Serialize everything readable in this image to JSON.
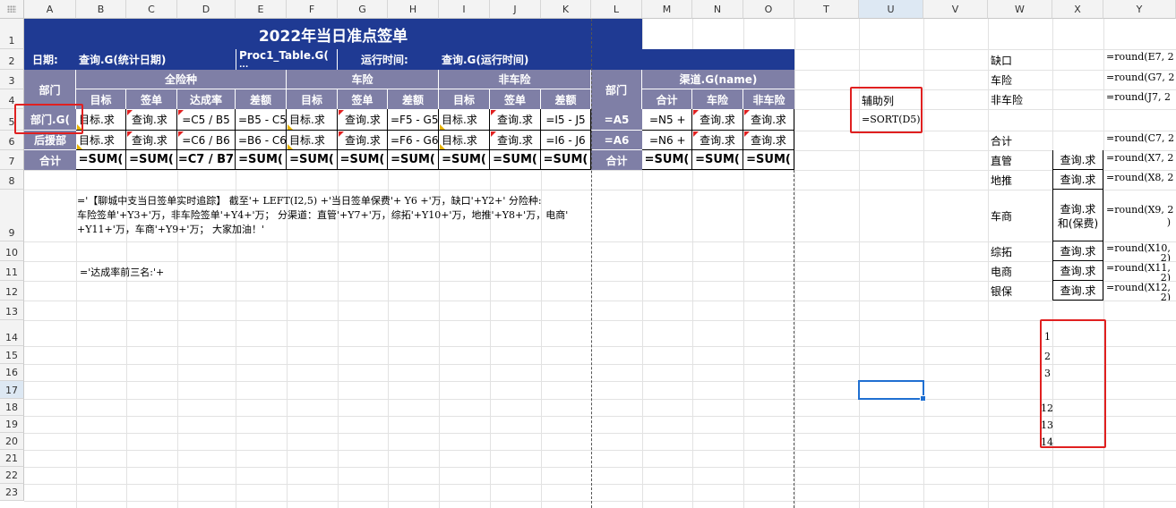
{
  "columns": [
    "A",
    "B",
    "C",
    "D",
    "E",
    "F",
    "G",
    "H",
    "I",
    "J",
    "K",
    "L",
    "M",
    "N",
    "O",
    "T",
    "U",
    "V",
    "W",
    "X",
    "Y"
  ],
  "rows": [
    "1",
    "2",
    "3",
    "4",
    "5",
    "6",
    "7",
    "8",
    "9",
    "10",
    "11",
    "12",
    "13",
    "14",
    "15",
    "16",
    "17",
    "18",
    "19",
    "20",
    "21",
    "22",
    "23"
  ],
  "title": "2022年当日准点签单",
  "row2": {
    "date_label": "日期:",
    "date_value": "查询.G(统计日期)",
    "proc": "Proc1_Table.G(",
    "proc_sub": "...",
    "runtime_label": "运行时间:",
    "runtime_value": "查询.G(运行时间)"
  },
  "headers": {
    "dept": "部门",
    "all": "全险种",
    "auto": "车险",
    "nonauto": "非车险",
    "channel": "渠道.G(name)",
    "dept2": "部门",
    "target": "目标",
    "signed": "签单",
    "rate": "达成率",
    "diff": "差额",
    "total": "合计",
    "car": "车险",
    "noncar": "非车险"
  },
  "row5": {
    "dept": "部门.G(",
    "b": "目标.求",
    "c": "查询.求",
    "d": "=C5 / B5",
    "e": "=B5 - C5",
    "f": "目标.求",
    "g": "查询.求",
    "h": "=F5 - G5",
    "i": "目标.求",
    "j": "查询.求",
    "k": "=I5 - J5",
    "l": "=A5",
    "m": "=N5 +",
    "n": "查询.求",
    "o": "查询.求"
  },
  "row6": {
    "dept": "后援部",
    "b": "目标.求",
    "c": "查询.求",
    "d": "=C6 / B6",
    "e": "=B6 - C6",
    "f": "目标.求",
    "g": "查询.求",
    "h": "=F6 - G6",
    "i": "目标.求",
    "j": "查询.求",
    "k": "=I6 - J6",
    "l": "=A6",
    "m": "=N6 +",
    "n": "查询.求",
    "o": "查询.求"
  },
  "row7": {
    "total": "合计",
    "b": "=SUM(",
    "c": "=SUM(",
    "d": "=C7 / B7",
    "e": "=SUM(",
    "f": "=SUM(",
    "g": "=SUM(",
    "h": "=SUM(",
    "i": "=SUM(",
    "j": "=SUM(",
    "k": "=SUM(",
    "l": "合计",
    "m": "=SUM(",
    "n": "=SUM(",
    "o": "=SUM("
  },
  "formula9": [
    "='【聊城中支当日签单实时追踪】 截至'+ LEFT(I2,5) +'当日签单保费'+ Y6 +'万，缺口'+Y2+' 分险种:",
    "车险签单'+Y3+'万，非车险签单'+Y4+'万； 分渠道：直管'+Y7+'万，综拓'+Y10+'万，地推'+Y8+'万，电商'",
    "+Y11+'万，车商'+Y9+'万； 大家加油！'"
  ],
  "formula11": "='达成率前三名:'+",
  "helper": {
    "label": "辅助列",
    "formula": "=SORT(D5)"
  },
  "right_labels": {
    "r2": "缺口",
    "r3": "车险",
    "r4": "非车险",
    "r6": "合计",
    "r7": "直管",
    "r8": "地推",
    "r9": "车商",
    "r10": "综拓",
    "r11": "电商",
    "r12": "银保"
  },
  "x_col": {
    "r7": "查询.求",
    "r8": "查询.求",
    "r9a": "查询.求",
    "r9b": "和(保费)",
    "r10": "查询.求",
    "r11": "查询.求",
    "r12": "查询.求"
  },
  "y_col": {
    "r2": "=round(E7, 2",
    "r3": "=round(G7, 2",
    "r4": "=round(J7, 2",
    "r6": "=round(C7, 2",
    "r7": "=round(X7, 2",
    "r8": "=round(X8, 2",
    "r9": "=round(X9, 2",
    "r9b": ")",
    "r10": "=round(X10,",
    "r10b": "2)",
    "r11": "=round(X11,",
    "r11b": "2)",
    "r12": "=round(X12,",
    "r12b": "2)"
  },
  "x_numbers": {
    "r14": "1",
    "r15": "2",
    "r16": "3",
    "r18": "12",
    "r19": "13",
    "r20": "14"
  },
  "colors": {
    "header_blue": "#1f3a93",
    "subheader_purple": "#7f7fa6",
    "highlight_red": "#e02020",
    "selection_blue": "#1f6fd1"
  }
}
